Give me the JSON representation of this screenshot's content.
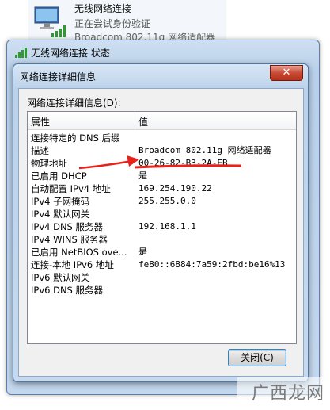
{
  "background_item": {
    "title": "无线网络连接",
    "status": "正在尝试身份验证",
    "adapter": "Broadcom 802.11g 网络适配器"
  },
  "status_window": {
    "title": "无线网络连接 状态"
  },
  "details_dialog": {
    "title": "网络连接详细信息",
    "close_glyph": "✕",
    "list_label": "网络连接详细信息(D):",
    "columns": {
      "property": "属性",
      "value": "值"
    },
    "rows": [
      {
        "property": "连接特定的 DNS 后缀",
        "value": ""
      },
      {
        "property": "描述",
        "value": "Broadcom 802.11g 网络适配器"
      },
      {
        "property": "物理地址",
        "value": "00-26-82-B3-2A-EB"
      },
      {
        "property": "已启用 DHCP",
        "value": "是"
      },
      {
        "property": "自动配置 IPv4 地址",
        "value": "169.254.190.22"
      },
      {
        "property": "IPv4 子网掩码",
        "value": "255.255.0.0"
      },
      {
        "property": "IPv4 默认网关",
        "value": ""
      },
      {
        "property": "IPv4 DNS 服务器",
        "value": "192.168.1.1"
      },
      {
        "property": "IPv4 WINS 服务器",
        "value": ""
      },
      {
        "property": "已启用 NetBIOS ove...",
        "value": "是"
      },
      {
        "property": "连接-本地 IPv6 地址",
        "value": "fe80::6884:7a59:2fbd:be16%13"
      },
      {
        "property": "IPv6 默认网关",
        "value": ""
      },
      {
        "property": "IPv6 DNS 服务器",
        "value": ""
      }
    ],
    "close_button": "关闭(C)"
  },
  "annotation_color": "#e8221b",
  "watermark": "广西龙网"
}
